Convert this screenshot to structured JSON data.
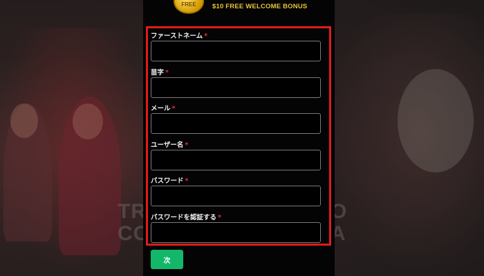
{
  "promo": {
    "coin_text": "FREE",
    "bonus_text": "$10 FREE WELCOME BONUS",
    "accent_color": "#e9c43a"
  },
  "background": {
    "left_text_line1": "TR",
    "left_text_line2": "CO",
    "right_text_line1": "O",
    "right_text_line2": "A"
  },
  "form": {
    "required_marker": "*",
    "fields": [
      {
        "label": "ファーストネーム",
        "value": "",
        "placeholder": ""
      },
      {
        "label": "苗字",
        "value": "",
        "placeholder": ""
      },
      {
        "label": "メール",
        "value": "",
        "placeholder": ""
      },
      {
        "label": "ユーザー名",
        "value": "",
        "placeholder": ""
      },
      {
        "label": "パスワード",
        "value": "",
        "placeholder": ""
      },
      {
        "label": "パスワードを認証する",
        "value": "",
        "placeholder": ""
      }
    ]
  },
  "next_button": {
    "label": "次",
    "color": "#12b76a"
  },
  "highlight_color": "#e01b1b"
}
